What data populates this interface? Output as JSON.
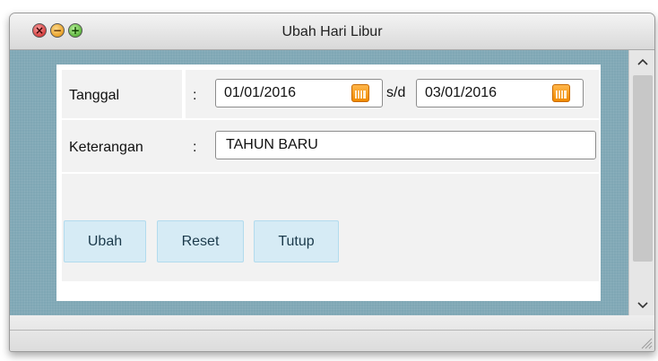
{
  "window": {
    "title": "Ubah Hari Libur"
  },
  "form": {
    "tanggal_label": "Tanggal",
    "keterangan_label": "Keterangan",
    "colon": ":",
    "date_from": "01/01/2016",
    "date_sep": "s/d",
    "date_to": "03/01/2016",
    "keterangan_value": "TAHUN BARU"
  },
  "buttons": {
    "ubah": "Ubah",
    "reset": "Reset",
    "tutup": "Tutup"
  },
  "scrollbar": {
    "up": "^",
    "down": "v"
  },
  "icons": {
    "close": "close-icon",
    "minimize": "minimize-icon",
    "maximize": "maximize-icon",
    "calendar": "calendar-icon",
    "resize": "resize-grip-icon"
  }
}
